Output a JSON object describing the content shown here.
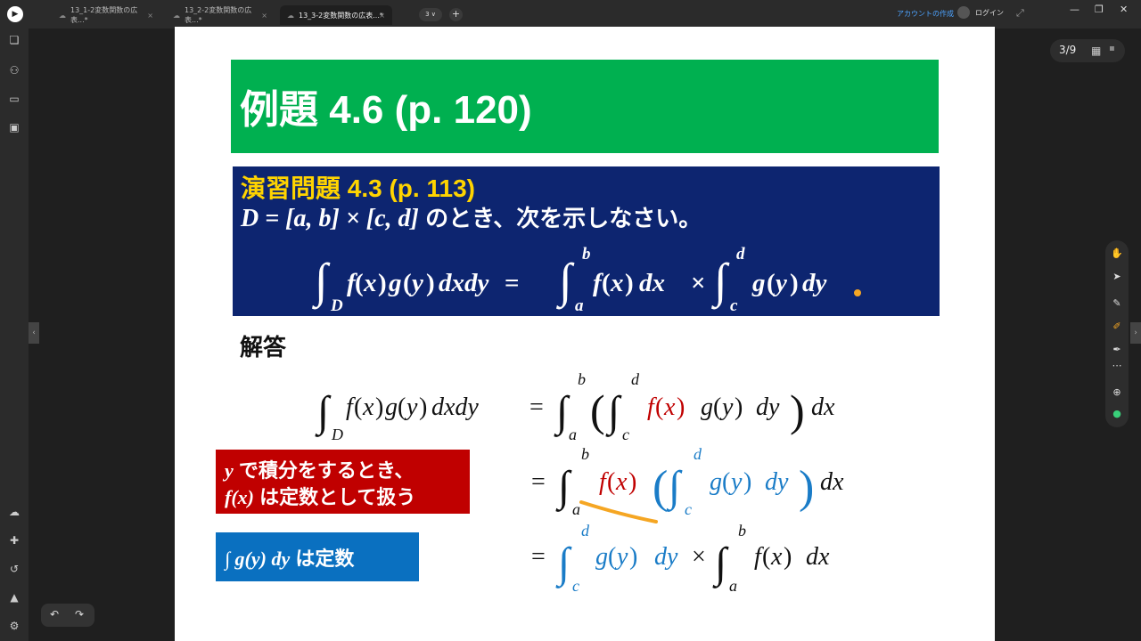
{
  "tabs": [
    {
      "label": "13_1-2変数関数の広表...*"
    },
    {
      "label": "13_2-2変数関数の広表...*"
    },
    {
      "label": "13_3-2変数関数の広表...*"
    }
  ],
  "toolbar": {
    "page_count_badge": "3 ∨",
    "add_tab": "+",
    "create_account": "アカウントの作成",
    "login": "ログイン"
  },
  "page_indicator": "3/9",
  "slide": {
    "title": "例題 4.6 (p. 120)",
    "exercise_title": "演習問題 4.3 (p. 113)",
    "exercise_prefix_math": "D = [a, b] × [c, d]",
    "exercise_text": " のとき、次を示しなさい。",
    "answer_label": "解答",
    "red_callout_line1_var": "y",
    "red_callout_line1": " で積分をするとき、",
    "red_callout_line2_var": "f(x)",
    "red_callout_line2": " は定数として扱う",
    "blue_callout_math": "∫ g(y) dy",
    "blue_callout_text": " は定数"
  },
  "colors": {
    "title_bar": "#00b050",
    "exercise_bg": "#0d2570",
    "exercise_title": "#ffd400",
    "red_callout": "#c00000",
    "blue_callout": "#0a70c0",
    "red_text": "#c00000",
    "blue_text": "#1a7cc7",
    "annotation_orange": "#f5a623"
  },
  "icons": [
    "app-logo-icon",
    "cloud-icon",
    "close-icon",
    "grid-icon",
    "hand-icon",
    "pointer-icon",
    "eraser-icon",
    "pen-icon",
    "highlighter-icon",
    "more-icon",
    "plus-icon",
    "undo-icon",
    "redo-icon"
  ]
}
